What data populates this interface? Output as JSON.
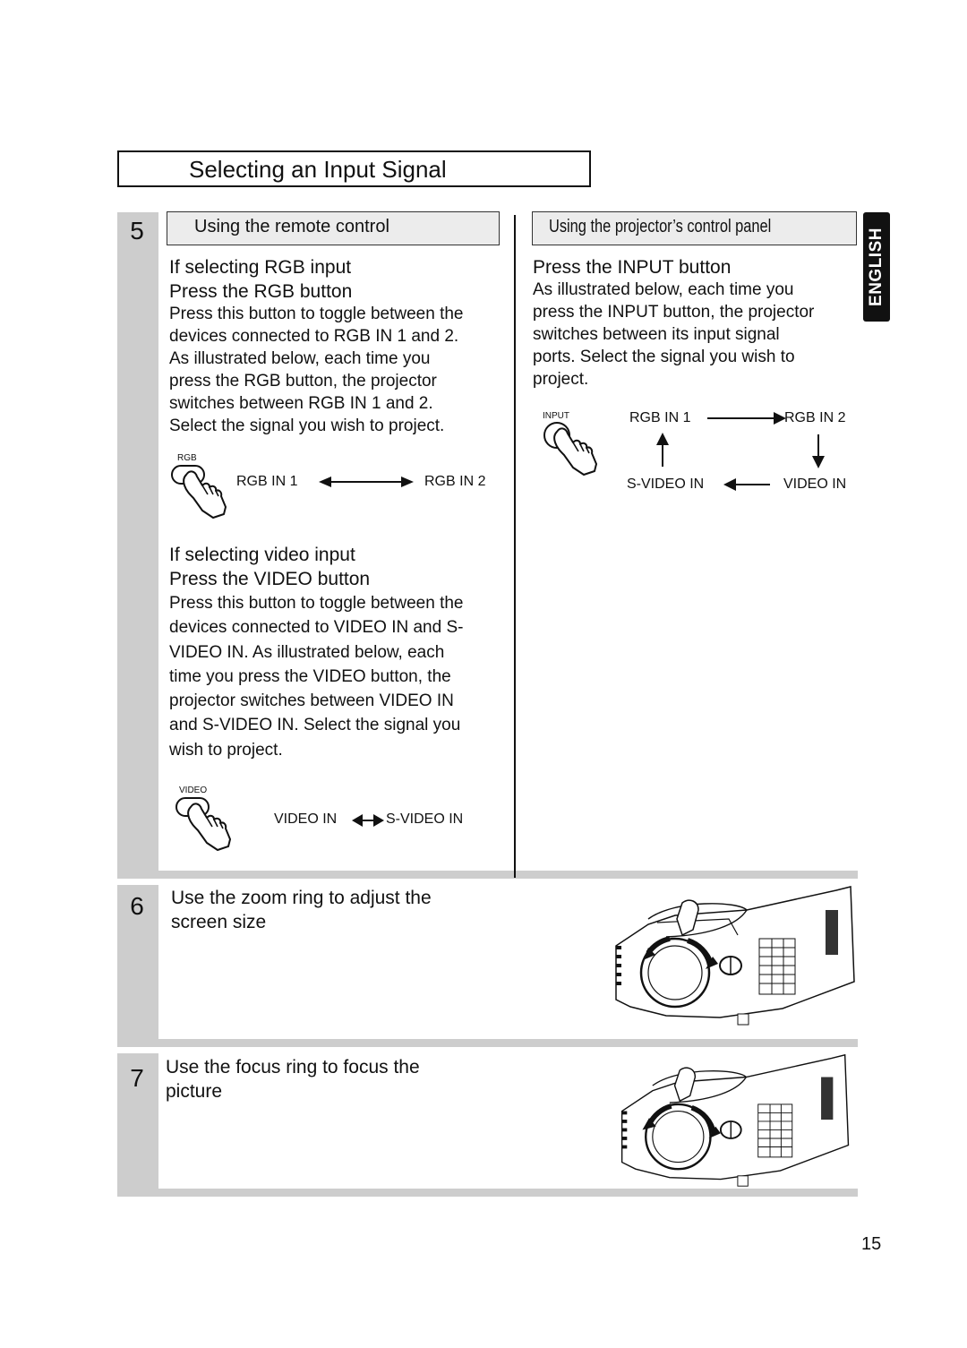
{
  "page": {
    "section_title": "Selecting an Input Signal",
    "language_tab": "ENGLISH",
    "page_number": "15"
  },
  "step5": {
    "number": "5",
    "remote": {
      "heading": "Using the remote control",
      "rgb": {
        "line1": "If selecting RGB input",
        "line2": "Press the RGB button",
        "body": [
          "Press this button to toggle between the",
          "devices connected to RGB IN 1 and 2.",
          "As illustrated below, each time you",
          "press the RGB button, the projector",
          "switches between RGB IN 1 and 2.",
          "Select the signal you wish to project."
        ],
        "button_label": "RGB",
        "diagram": {
          "left": "RGB IN 1",
          "right": "RGB IN 2"
        }
      },
      "video": {
        "line1": "If selecting video input",
        "line2": "Press the VIDEO button",
        "body": [
          "Press this button to toggle between the",
          "devices connected to VIDEO IN and S-",
          "VIDEO IN. As illustrated below, each",
          "time you press the VIDEO button, the",
          "projector switches between VIDEO IN",
          "and S-VIDEO IN. Select the signal you",
          "wish to project."
        ],
        "button_label": "VIDEO",
        "diagram": {
          "left": "VIDEO IN",
          "right": "S-VIDEO IN"
        }
      }
    },
    "panel": {
      "heading": "Using the projector’s control panel",
      "line1": "Press the INPUT button",
      "body": [
        "As illustrated below, each time you",
        "press the INPUT button, the projector",
        "switches between its input signal",
        "ports. Select the signal you wish to",
        "project."
      ],
      "button_label": "INPUT",
      "cycle": [
        "RGB IN 1",
        "RGB IN 2",
        "VIDEO IN",
        "S-VIDEO IN"
      ]
    }
  },
  "step6": {
    "number": "6",
    "text": [
      "Use the zoom ring to adjust the",
      "screen size"
    ]
  },
  "step7": {
    "number": "7",
    "text": [
      "Use the focus ring to focus the",
      "picture"
    ]
  },
  "colors": {
    "band_grey": "#cdcdcd",
    "header_grey": "#ececec",
    "ink": "#111111"
  }
}
